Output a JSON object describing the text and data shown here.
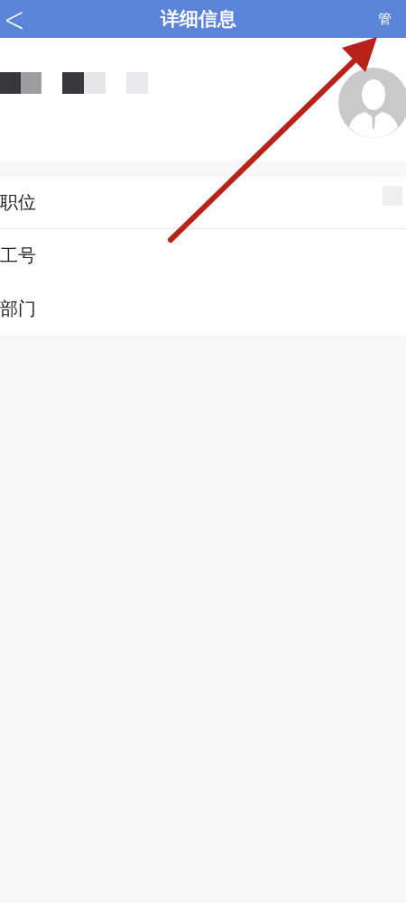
{
  "nav_bar": {
    "back": "<",
    "title": "详细信息",
    "action": "管"
  },
  "rows": [
    {
      "label": "职位"
    },
    {
      "label": "工号"
    },
    {
      "label": "部门"
    }
  ]
}
